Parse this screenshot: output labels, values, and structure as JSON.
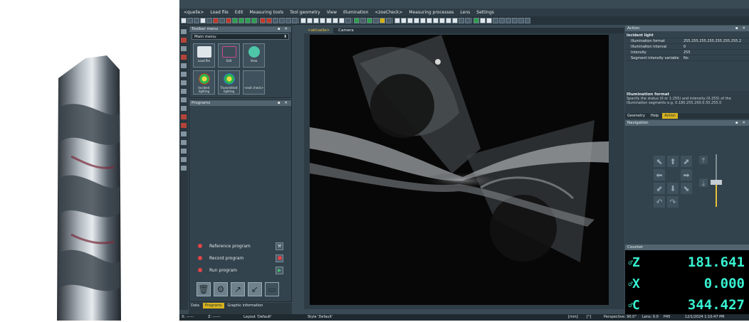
{
  "menu": [
    "<quelle>",
    "Load file",
    "Edit",
    "Measuring tools",
    "Tool geometry",
    "View",
    "Illumination",
    "<zoeCheck>",
    "Measuring processes",
    "Lens",
    "Settings"
  ],
  "toolbar_menu": {
    "title": "Toolbar menu",
    "main_menu": "Main menu",
    "tiles": [
      {
        "label": "Load file",
        "icon": "floppy-disk-icon",
        "color": "#dfe6ea"
      },
      {
        "label": "Edit",
        "icon": "edit-frame-icon",
        "color": "#3d4d57"
      },
      {
        "label": "View",
        "icon": "view-icon",
        "color": "#4ec6a8"
      },
      {
        "label": "Incident lighting",
        "icon": "incident-light-icon",
        "color": "#2bb44a"
      },
      {
        "label": "Transmitted lighting",
        "icon": "transmitted-light-icon",
        "color": "#2bb44a"
      },
      {
        "label": "<exit check>",
        "icon": "empty-tile-icon",
        "color": "#3f515c"
      }
    ]
  },
  "programs": {
    "title": "Programs",
    "rows": [
      {
        "label": "Reference program",
        "action": "tool-icon"
      },
      {
        "label": "Record program",
        "action": "record-icon"
      },
      {
        "label": "Run program",
        "action": "play-icon"
      }
    ],
    "tabs": [
      {
        "label": "Data",
        "active": false
      },
      {
        "label": "Programs",
        "active": true
      }
    ],
    "graphic_tab": "Graphic information"
  },
  "camera": {
    "tabs": [
      {
        "label": "<aktuelle>",
        "active": true
      },
      {
        "label": "Camera",
        "active": false
      }
    ]
  },
  "action_panel": {
    "title": "Action",
    "group": "Incident light",
    "properties": [
      {
        "key": "Illumination format",
        "value": "255.255.255.255.255.255.255.2"
      },
      {
        "key": "Illumination interval",
        "value": "0"
      },
      {
        "key": "Intensity",
        "value": "255"
      },
      {
        "key": "Segment intensity variable",
        "value": "No"
      }
    ],
    "help_title": "Illumination format",
    "help_text_1": "Specify the status (0 or 1:255) and intensity (0-255) of the",
    "help_text_2": "illumination segments e.g. 0.180.255.200.0.50.255.0",
    "tabs": [
      {
        "label": "Geometry",
        "active": false
      },
      {
        "label": "Help",
        "active": false
      },
      {
        "label": "Action",
        "active": true
      }
    ]
  },
  "navigation": {
    "title": "Navigation"
  },
  "counter": {
    "title": "Counter",
    "rows": [
      {
        "axis": "Z",
        "value": "181.641"
      },
      {
        "axis": "X",
        "value": "0.000"
      },
      {
        "axis": "C",
        "value": "344.427"
      }
    ]
  },
  "status": {
    "x": "X: ------",
    "z": "Z: ------",
    "layout": "Layout 'Default'",
    "style": "Style 'Default'",
    "unit": "[mm]",
    "angle": "[°]",
    "perspective": "Perspective: 90.0°",
    "lens": "Lens: 0.0",
    "p": "P45",
    "datetime": "12/1/2024 1:10:47 PM"
  }
}
